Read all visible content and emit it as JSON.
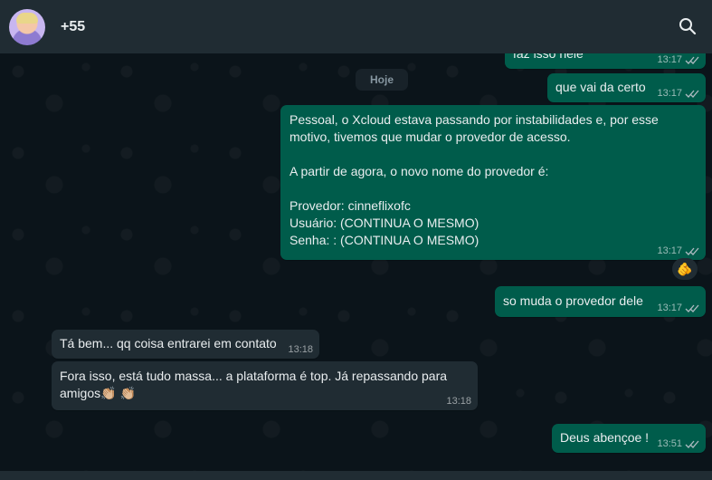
{
  "header": {
    "contact_name": "+55",
    "search_icon": "search-icon",
    "avatar_icon": "avatar"
  },
  "chat": {
    "day_separator": "Hoje",
    "messages": [
      {
        "direction": "out",
        "text": "faz isso nele",
        "time": "13:17"
      },
      {
        "direction": "out",
        "text": "que vai da certo",
        "time": "13:17"
      },
      {
        "direction": "out",
        "text": "Pessoal, o Xcloud estava passando por instabilidades e, por esse\nmotivo, tivemos que mudar o provedor de acesso.\n\nA partir de agora, o novo nome do provedor é:\n\nProvedor: cinneflixofc\nUsuário: (CONTINUA O MESMO)\nSenha: : (CONTINUA O MESMO)",
        "time": "13:17"
      },
      {
        "direction": "out",
        "text": "so muda o provedor dele",
        "time": "13:17"
      },
      {
        "direction": "in",
        "text": "Tá bem... qq coisa entrarei em contato",
        "time": "13:18"
      },
      {
        "direction": "in",
        "text": "Fora isso, está tudo massa... a plataforma é top. Já repassando para\namigos👏🏼 👏🏼",
        "time": "13:18"
      },
      {
        "direction": "out",
        "text": "Deus abençoe !",
        "time": "13:51"
      }
    ],
    "reaction": "🫵"
  },
  "colors": {
    "outgoing_bubble": "#005c4b",
    "incoming_bubble": "#202c33",
    "background": "#0b141a",
    "read_ticks": "#53bdeb"
  }
}
